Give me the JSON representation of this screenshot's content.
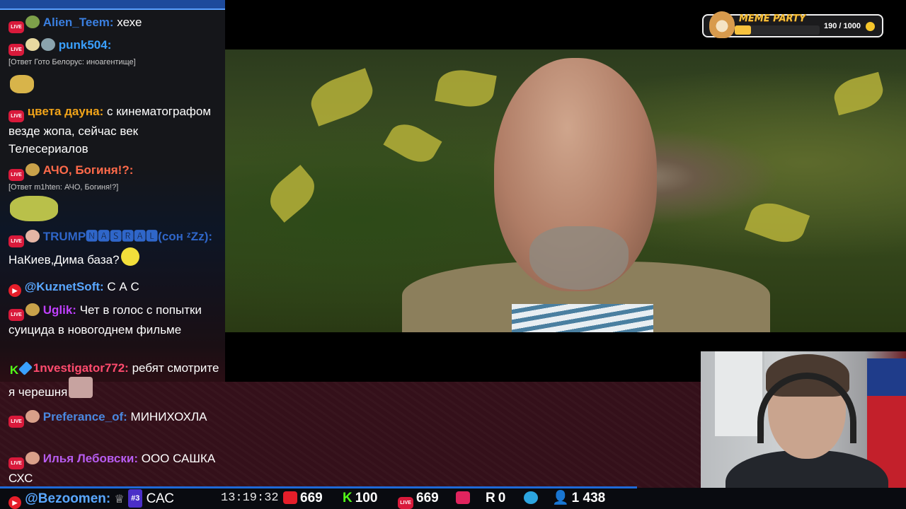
{
  "meme_party": {
    "title": "MEME PARTY",
    "current": 190,
    "max": 1000,
    "count_text": "190 / 1000",
    "progress_fraction": 0.19
  },
  "chat": {
    "messages": [
      {
        "platform": "live",
        "nick": "Alien_Teem:",
        "nick_color": "#3a7fe0",
        "text": "хехе"
      },
      {
        "platform": "live",
        "nick": "punk504:",
        "nick_color": "#3aa0ff",
        "text": ""
      },
      {
        "reply": "[Ответ Гото Белорус: иноагентище]"
      },
      {
        "platform": "live",
        "nick": "цвета дауна:",
        "nick_color": "#f2a419",
        "text": "с кинематографом везде жопа, сейчас век Телесериалов"
      },
      {
        "platform": "live",
        "nick": "АЧО, Богиня!?:",
        "nick_color": "#ff6a4a",
        "text": ""
      },
      {
        "reply": "[Ответ m1hten: АЧО, Богиня!?]"
      },
      {
        "platform": "live",
        "nick": "TRUMP🅽🅰🆂🆁🅰🅻(сон ᶻZz):",
        "nick_color": "#2f66c9",
        "text": "НаКиев,Дима база?"
      },
      {
        "platform": "youtube",
        "nick": "@KuznetSoft:",
        "nick_color": "#59a7ff",
        "text": "С А С"
      },
      {
        "platform": "live",
        "nick": "Uglik:",
        "nick_color": "#c040ff",
        "text": "Чет в голос с попытки суицида в новогоднем фильме"
      },
      {
        "platform": "kick",
        "nick": "1nvestigator772:",
        "nick_color": "#ff4b6e",
        "text": "ребят смотрите я черешня"
      },
      {
        "platform": "live",
        "nick": "Preferance_of:",
        "nick_color": "#4a88e0",
        "text": "МИНИХОХЛА"
      },
      {
        "platform": "live",
        "nick": "Илья Лебовски:",
        "nick_color": "#b75cf0",
        "text": "ООО САШКА СХС"
      }
    ]
  },
  "bottom_bar": {
    "last_message": {
      "platform": "youtube",
      "nick": "@Bezoomen:",
      "rank": "#3",
      "text": "САС"
    },
    "time": "13:19:32",
    "youtube_viewers": "669",
    "kick_viewers": "100",
    "live_viewers": "669",
    "other_viewers": "",
    "rutube_viewers": "0",
    "telegram": "",
    "total_viewers": "1 438"
  },
  "colors": {
    "youtube": "#e61e2a",
    "kick": "#53fc18",
    "live": "#d91a3b",
    "telegram": "#2ca5e0",
    "accent": "#1e6ad8"
  }
}
